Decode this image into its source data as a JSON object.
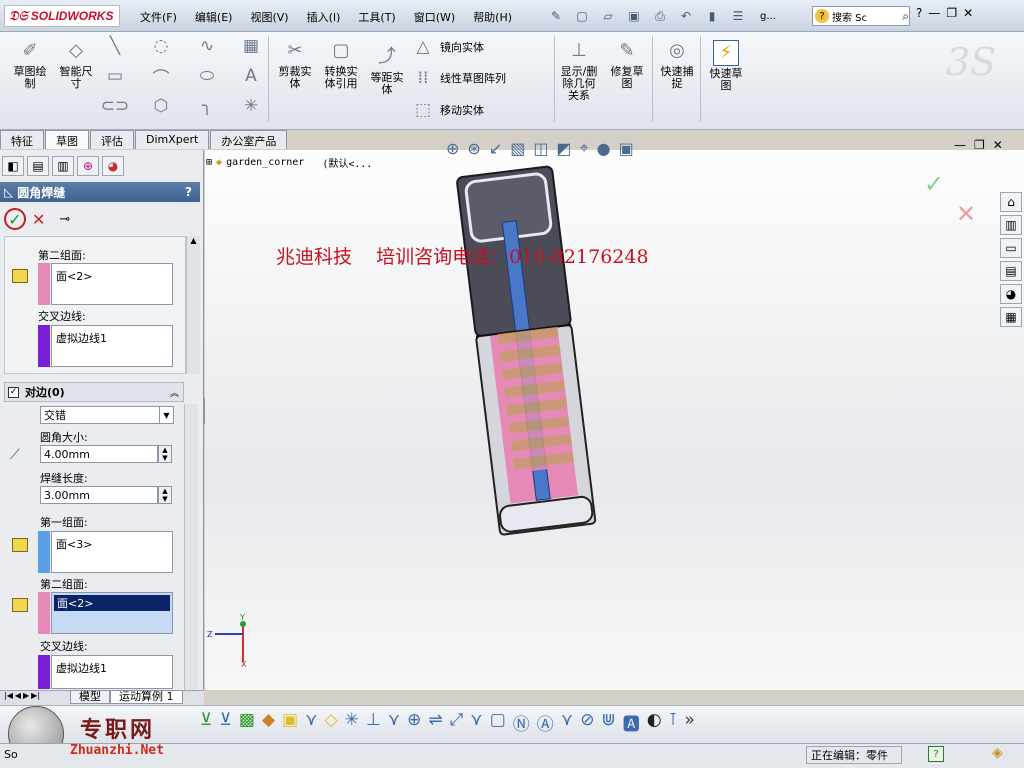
{
  "app": {
    "name": "SOLIDWORKS",
    "search_placeholder": "搜索 Sc",
    "doc_short": "g..."
  },
  "menu": [
    "文件(F)",
    "编辑(E)",
    "视图(V)",
    "插入(I)",
    "工具(T)",
    "窗口(W)",
    "帮助(H)"
  ],
  "ribbon": {
    "sketch": "草图绘\n制",
    "smart_dim": "智能尺\n寸",
    "trim": "剪裁实\n体",
    "convert": "转换实\n体引用",
    "offset": "等距实\n体",
    "mirror": "镜向实体",
    "linear_pattern": "线性草图阵列",
    "move": "移动实体",
    "display_relations": "显示/删\n除几何\n关系",
    "repair": "修复草\n图",
    "quick_snap": "快速捕\n捉",
    "rapid_sketch": "快速草\n图"
  },
  "tabs": [
    "特征",
    "草图",
    "评估",
    "DimXpert",
    "办公室产品"
  ],
  "active_tab": "草图",
  "pm": {
    "title": "圆角焊缝",
    "group1": {
      "second_face_label": "第二组面:",
      "second_face_value": "面<2>",
      "edge_label": "交叉边线:",
      "edge_value": "虚拟边线1"
    },
    "opposite": {
      "title": "对边(0)",
      "type": "交错",
      "fillet_size_label": "圆角大小:",
      "fillet_size": "4.00mm",
      "weld_length_label": "焊缝长度:",
      "weld_length": "3.00mm",
      "first_face_label": "第一组面:",
      "first_face_value": "面<3>",
      "second_face_label": "第二组面:",
      "second_face_value": "面<2>",
      "edge_label": "交叉边线:",
      "edge_value": "虚拟边线1"
    }
  },
  "tree": {
    "part": "garden_corner",
    "config": "(默认<..."
  },
  "overlay": "兆迪科技    培训咨询电话：010-82176248",
  "bottom_tabs": [
    "模型",
    "运动算例 1"
  ],
  "status": {
    "left": "So",
    "editing": "正在编辑：零件"
  },
  "watermark": {
    "name": "专职网",
    "url": "Zhuanzhi.Net"
  },
  "triad": {
    "y": "Y",
    "z": "Z",
    "x": "X"
  },
  "colors": {
    "pink": "#e58ab6",
    "purple": "#7a1fd6",
    "blue": "#5aa0e6",
    "selection": "#0a246a"
  }
}
